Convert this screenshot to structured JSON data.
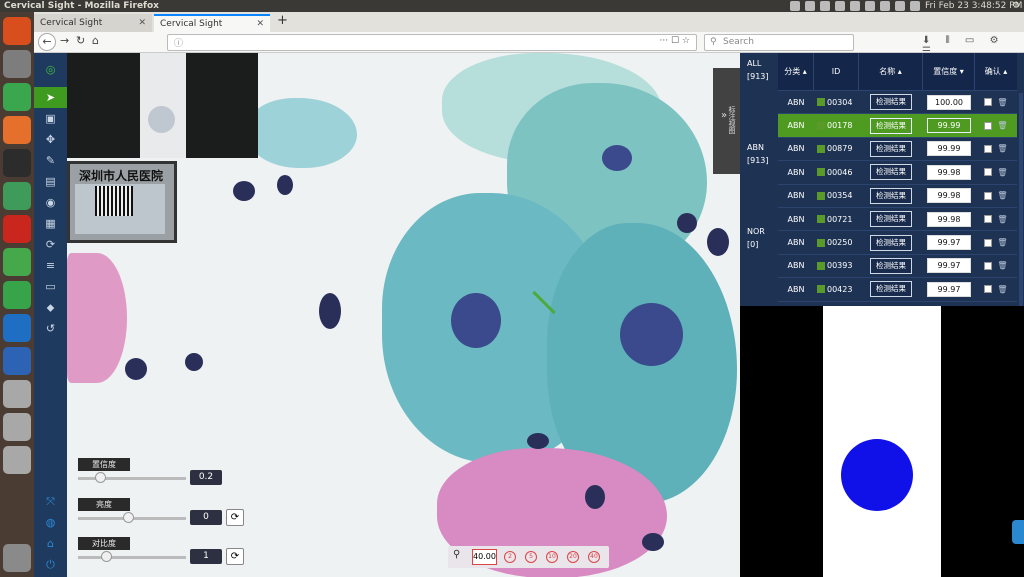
{
  "os": {
    "window_title": "Cervical Sight - Mozilla Firefox",
    "clock": "Fri Feb 23  3:48:52 PM"
  },
  "browser": {
    "tabs": [
      {
        "label": "Cervical Sight"
      },
      {
        "label": "Cervical Sight"
      }
    ],
    "search_placeholder": "Search"
  },
  "viewer": {
    "label_text": "深圳市人民医院",
    "sliders": [
      {
        "label": "置信度",
        "value": "0.2",
        "fraction": 0.22
      },
      {
        "label": "亮度",
        "value": "0",
        "fraction": 0.5
      },
      {
        "label": "对比度",
        "value": "1",
        "fraction": 0.28
      }
    ],
    "zoom": {
      "value": "40.00",
      "buttons": [
        "2",
        "5",
        "10",
        "20",
        "40"
      ]
    },
    "side_tab": "标注视图"
  },
  "panel": {
    "categories": [
      {
        "name": "ALL",
        "count": "[913]"
      },
      {
        "name": "ABN",
        "count": "[913]"
      },
      {
        "name": "NOR",
        "count": "[0]"
      }
    ],
    "columns": [
      "分类",
      "ID",
      "名称",
      "置信度",
      "确认"
    ],
    "rows": [
      {
        "class": "ABN",
        "id": "00304",
        "name": "检测结果",
        "conf": "100.00",
        "selected": false
      },
      {
        "class": "ABN",
        "id": "00178",
        "name": "检测结果",
        "conf": "99.99",
        "selected": true
      },
      {
        "class": "ABN",
        "id": "00879",
        "name": "检测结果",
        "conf": "99.99",
        "selected": false
      },
      {
        "class": "ABN",
        "id": "00046",
        "name": "检测结果",
        "conf": "99.98",
        "selected": false
      },
      {
        "class": "ABN",
        "id": "00354",
        "name": "检测结果",
        "conf": "99.98",
        "selected": false
      },
      {
        "class": "ABN",
        "id": "00721",
        "name": "检测结果",
        "conf": "99.98",
        "selected": false
      },
      {
        "class": "ABN",
        "id": "00250",
        "name": "检测结果",
        "conf": "99.97",
        "selected": false
      },
      {
        "class": "ABN",
        "id": "00393",
        "name": "检测结果",
        "conf": "99.97",
        "selected": false
      },
      {
        "class": "ABN",
        "id": "00423",
        "name": "检测结果",
        "conf": "99.97",
        "selected": false
      }
    ]
  },
  "colors": {
    "accent_green": "#4f9b22",
    "panel_bg": "#1e3354",
    "toolbar_bg": "#1f3a5f"
  }
}
